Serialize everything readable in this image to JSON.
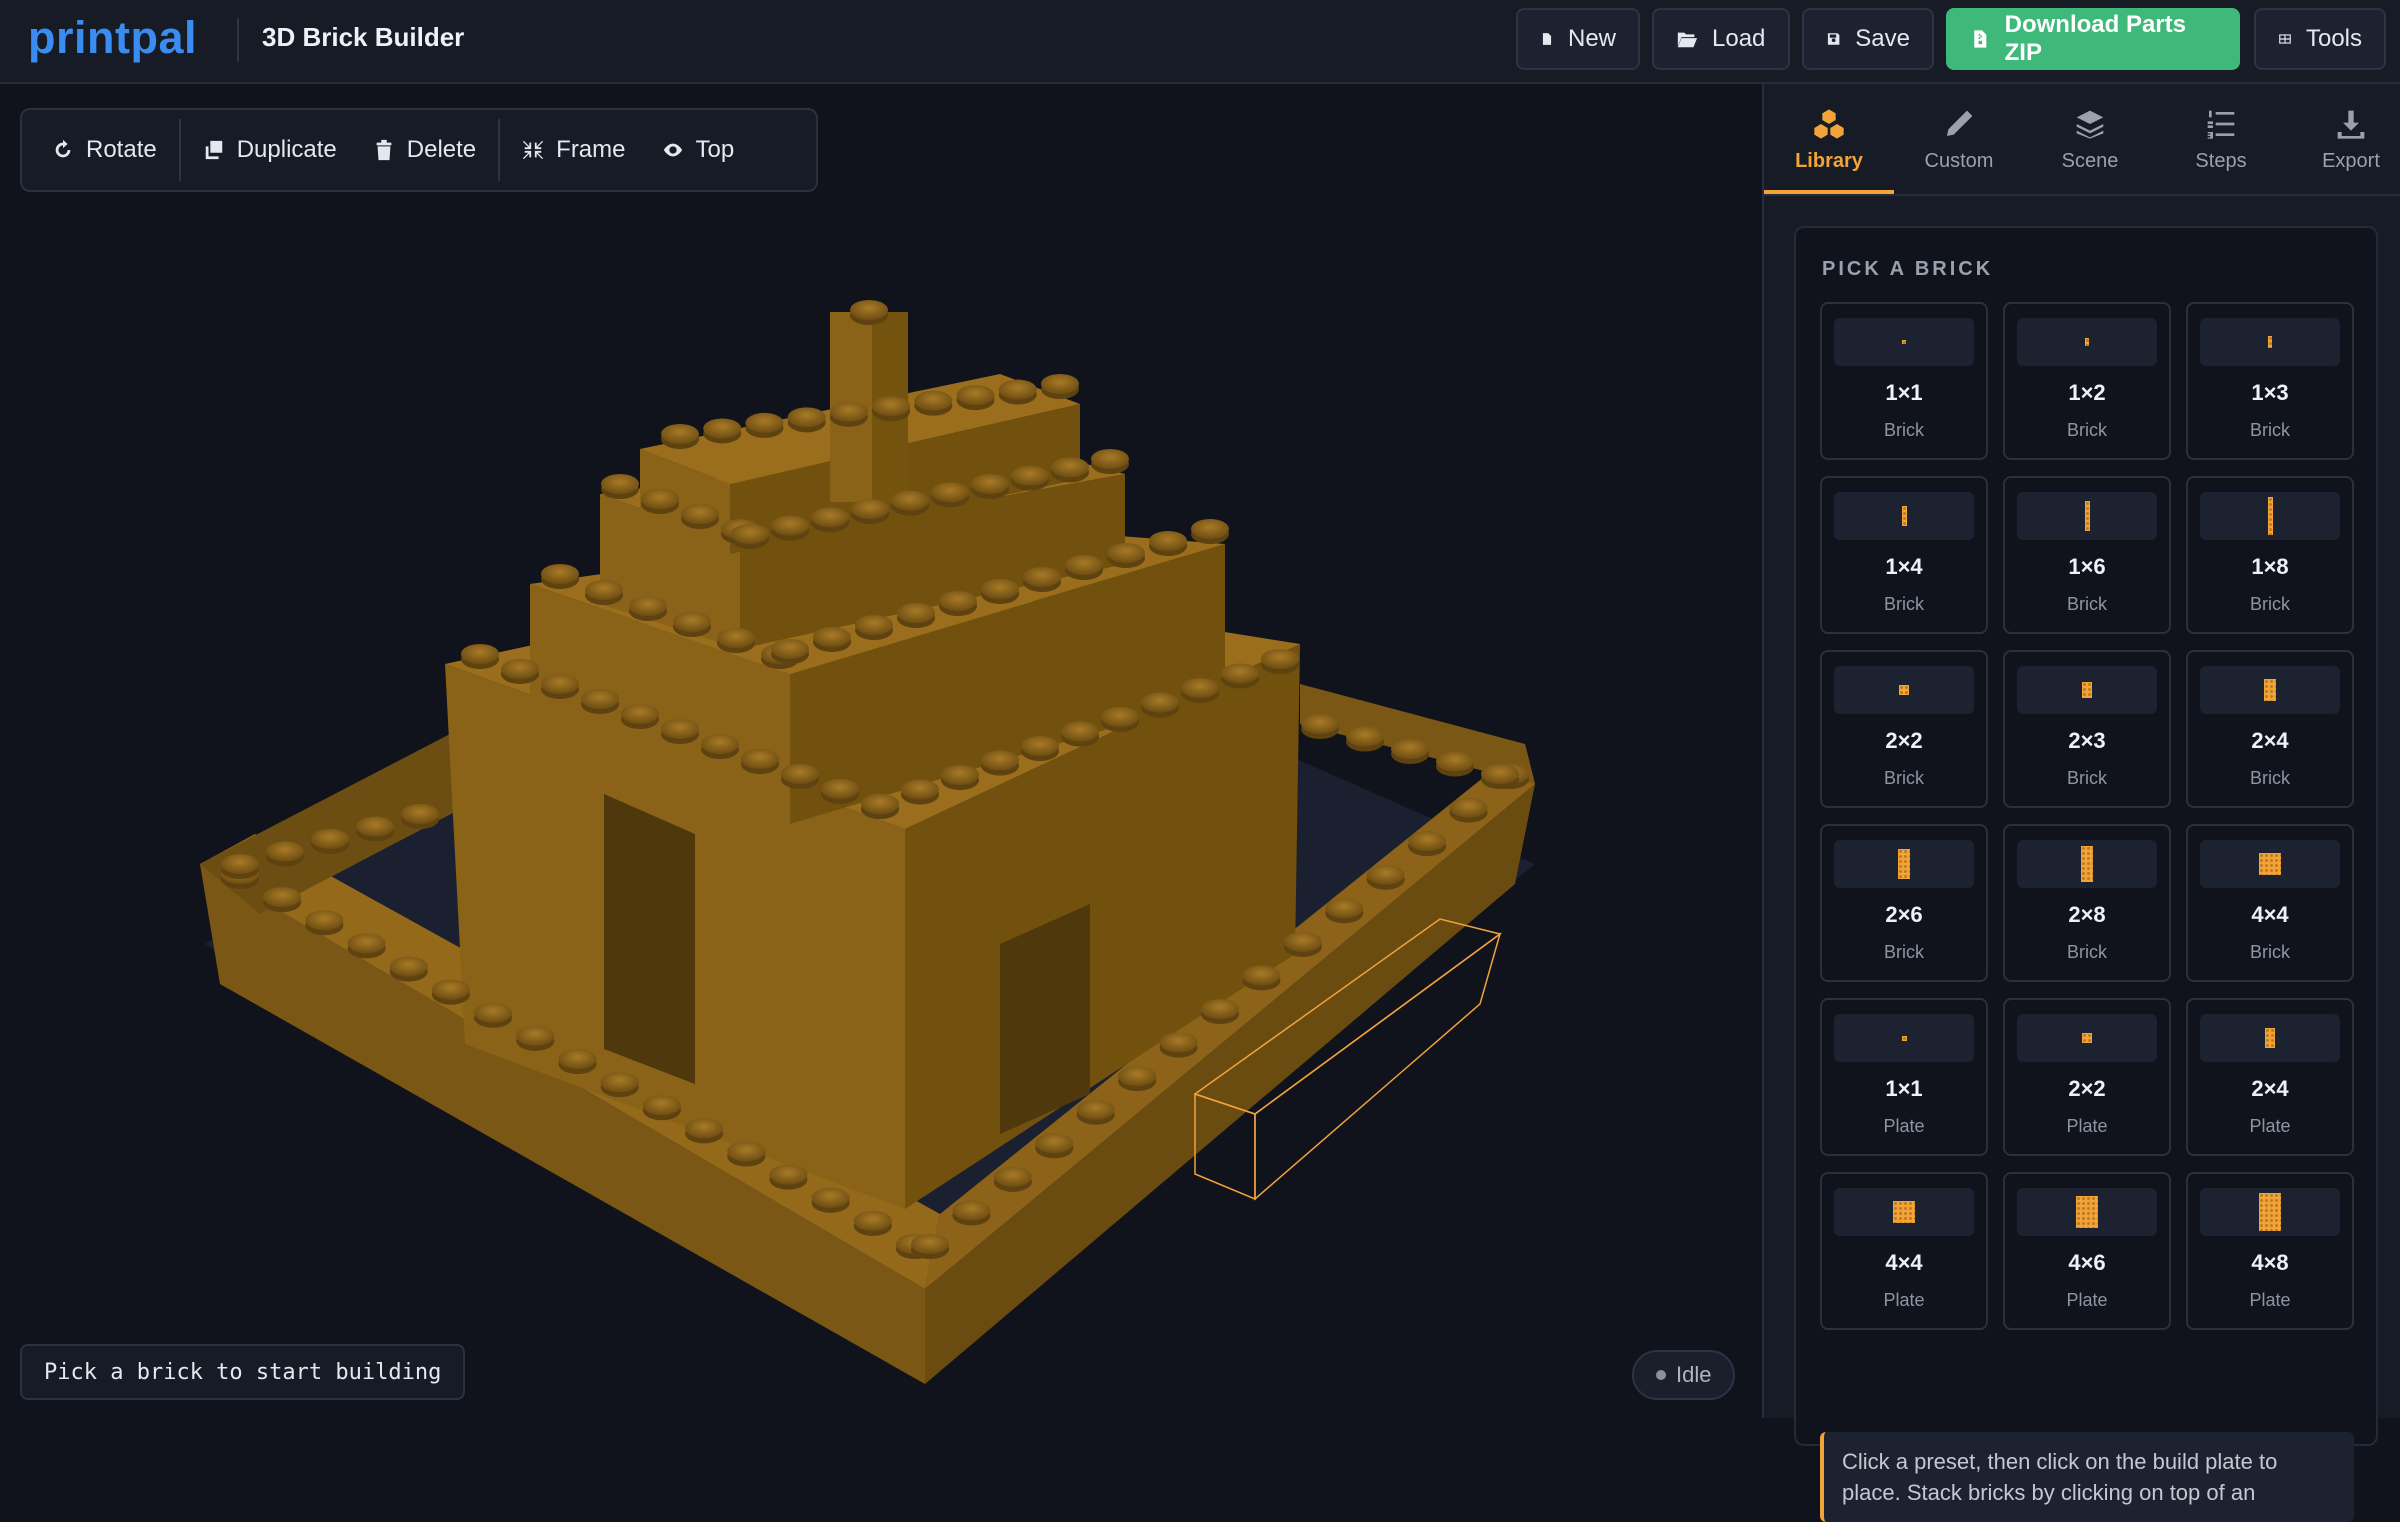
{
  "app": {
    "logo": "printpal",
    "title": "3D Brick Builder"
  },
  "topbar": {
    "new_label": "New",
    "load_label": "Load",
    "save_label": "Save",
    "download_label": "Download Parts ZIP",
    "tools_label": "Tools"
  },
  "viewport_toolbar": {
    "rotate_label": "Rotate",
    "duplicate_label": "Duplicate",
    "delete_label": "Delete",
    "frame_label": "Frame",
    "top_label": "Top"
  },
  "status": {
    "message": "Pick a brick to start building",
    "state": "Idle"
  },
  "tabs": [
    {
      "label": "Library",
      "icon": "cubes-icon",
      "active": true
    },
    {
      "label": "Custom",
      "icon": "pencil-icon",
      "active": false
    },
    {
      "label": "Scene",
      "icon": "layers-icon",
      "active": false
    },
    {
      "label": "Steps",
      "icon": "numbered-list-icon",
      "active": false
    },
    {
      "label": "Export",
      "icon": "download-icon",
      "active": false
    }
  ],
  "library": {
    "heading": "PICK A BRICK",
    "bricks": [
      {
        "size": "1×1",
        "kind": "Brick"
      },
      {
        "size": "1×2",
        "kind": "Brick"
      },
      {
        "size": "1×3",
        "kind": "Brick"
      },
      {
        "size": "1×4",
        "kind": "Brick"
      },
      {
        "size": "1×6",
        "kind": "Brick"
      },
      {
        "size": "1×8",
        "kind": "Brick"
      },
      {
        "size": "2×2",
        "kind": "Brick"
      },
      {
        "size": "2×3",
        "kind": "Brick"
      },
      {
        "size": "2×4",
        "kind": "Brick"
      },
      {
        "size": "2×6",
        "kind": "Brick"
      },
      {
        "size": "2×8",
        "kind": "Brick"
      },
      {
        "size": "4×4",
        "kind": "Brick"
      },
      {
        "size": "1×1",
        "kind": "Plate"
      },
      {
        "size": "2×2",
        "kind": "Plate"
      },
      {
        "size": "2×4",
        "kind": "Plate"
      },
      {
        "size": "4×4",
        "kind": "Plate"
      },
      {
        "size": "4×6",
        "kind": "Plate"
      },
      {
        "size": "4×8",
        "kind": "Plate"
      }
    ],
    "hint": "Click a preset, then click on the build plate to place. Stack bricks by clicking on top of an"
  },
  "colors": {
    "accent": "#f2a33a",
    "brand": "#3b8cf0",
    "download": "#3fb97a",
    "brick": "#8a6218"
  }
}
